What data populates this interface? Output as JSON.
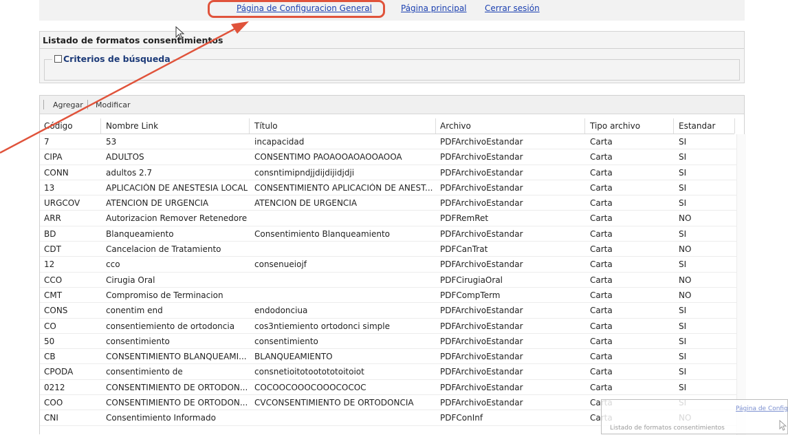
{
  "nav": {
    "config_link": "Página de Configuracion General",
    "home_link": "Página principal",
    "logout_link": "Cerrar sesión"
  },
  "panel": {
    "title": "Listado de formatos consentimientos",
    "criteria_label": "Criterios de búsqueda"
  },
  "toolbar": {
    "add_label": "Agregar",
    "edit_label": "Modificar"
  },
  "columns": [
    "Código",
    "Nombre Link",
    "Título",
    "Archivo",
    "Tipo archivo",
    "Estandar"
  ],
  "rows": [
    [
      "7",
      "53",
      "incapacidad",
      "PDFArchivoEstandar",
      "Carta",
      "SI"
    ],
    [
      "CIPA",
      "ADULTOS",
      "CONSENTIMO PAOAOOAOAOOAOOA",
      "PDFArchivoEstandar",
      "Carta",
      "SI"
    ],
    [
      "CONN",
      "adultos 2.7",
      "consntimipndjjdijdijidjdji",
      "PDFArchivoEstandar",
      "Carta",
      "SI"
    ],
    [
      "13",
      "APLICACIÓN DE ANESTESIA LOCAL",
      "CONSENTIMIENTO APLICACIÓN DE ANEST...",
      "PDFArchivoEstandar",
      "Carta",
      "SI"
    ],
    [
      "URGCOV",
      "ATENCION DE URGENCIA",
      "ATENCION DE URGENCIA",
      "PDFArchivoEstandar",
      "Carta",
      "SI"
    ],
    [
      "ARR",
      "Autorizacion Remover Retenedores",
      "",
      "PDFRemRet",
      "Carta",
      "NO"
    ],
    [
      "BD",
      "Blanqueamiento",
      "Consentimiento Blanqueamiento",
      "PDFArchivoEstandar",
      "Carta",
      "SI"
    ],
    [
      "CDT",
      "Cancelacion de Tratamiento",
      "",
      "PDFCanTrat",
      "Carta",
      "NO"
    ],
    [
      "12",
      "cco",
      "consenueiojf",
      "PDFArchivoEstandar",
      "Carta",
      "SI"
    ],
    [
      "CCO",
      "Cirugia Oral",
      "",
      "PDFCirugiaOral",
      "Carta",
      "NO"
    ],
    [
      "CMT",
      "Compromiso de Terminacion",
      "",
      "PDFCompTerm",
      "Carta",
      "NO"
    ],
    [
      "CONS",
      "conentim end",
      "endodonciua",
      "PDFArchivoEstandar",
      "Carta",
      "SI"
    ],
    [
      "CO",
      "consentiemiento de ortodoncia",
      "cos3ntiemiento ortodonci simple",
      "PDFArchivoEstandar",
      "Carta",
      "SI"
    ],
    [
      "50",
      "consentimiento",
      "consentimiento",
      "PDFArchivoEstandar",
      "Carta",
      "SI"
    ],
    [
      "CB",
      "CONSENTIMIENTO BLANQUEAMI...",
      "BLANQUEAMIENTO",
      "PDFArchivoEstandar",
      "Carta",
      "SI"
    ],
    [
      "CPODA",
      "consentimiento de",
      "consnetioitotootototoitoiot",
      "PDFArchivoEstandar",
      "Carta",
      "SI"
    ],
    [
      "0212",
      "CONSENTIMIENTO DE ORTODON...",
      "COCOOCOOOCOOOCOCOC",
      "PDFArchivoEstandar",
      "Carta",
      "SI"
    ],
    [
      "COO",
      "CONSENTIMIENTO DE ORTODON...",
      "CVCONSENTIMIENTO DE ORTODONCIA",
      "PDFArchivoEstandar",
      "Carta",
      "SI"
    ],
    [
      "CNI",
      "Consentimiento Informado",
      "",
      "PDFConInf",
      "Carta",
      "NO"
    ]
  ],
  "overlay": {
    "ghost_link": "Página de Configu",
    "ghost_title": "Listado de formatos consentimientos"
  },
  "colors": {
    "link": "#1a3fb0",
    "highlight": "#e0533b",
    "legend": "#1c3a78"
  }
}
